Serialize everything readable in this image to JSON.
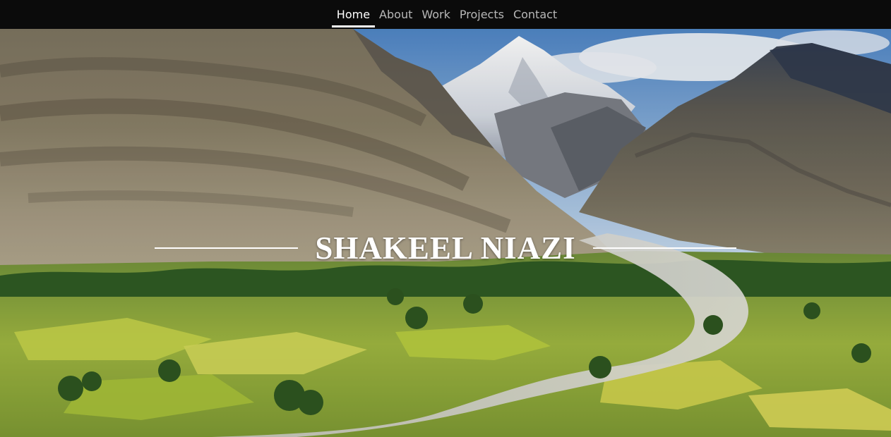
{
  "nav": {
    "items": [
      {
        "label": "Home",
        "active": true
      },
      {
        "label": "About",
        "active": false
      },
      {
        "label": "Work",
        "active": false
      },
      {
        "label": "Projects",
        "active": false
      },
      {
        "label": "Contact",
        "active": false
      }
    ]
  },
  "hero": {
    "title": "SHAKEEL NIAZI",
    "background": "mountain-valley-photo"
  },
  "colors": {
    "navbar_bg": "#0b0b0b",
    "nav_active": "#ffffff",
    "nav_inactive": "#b8b8b8",
    "title": "#ffffff"
  }
}
